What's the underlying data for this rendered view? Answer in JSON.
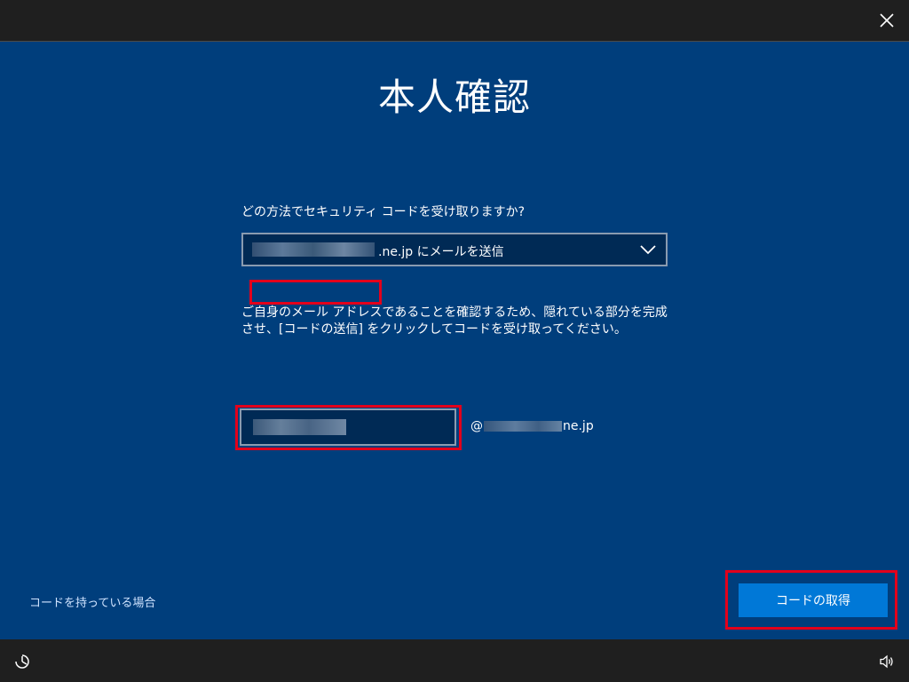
{
  "header": {
    "close_icon": "close-icon"
  },
  "main": {
    "title": "本人確認",
    "question": "どの方法でセキュリティ コードを受け取りますか?",
    "method_select": {
      "value": ".ne.jp にメールを送信"
    },
    "description": "ご自身のメール アドレスであることを確認するため、隠れている部分を完成させ、[コードの送信] をクリックしてコードを受け取ってください。",
    "email_input": {
      "value": "",
      "placeholder": ""
    },
    "domain_prefix": "@",
    "domain_suffix": "ne.jp"
  },
  "footer": {
    "have_code_link": "コードを持っている場合",
    "get_code_button": "コードの取得"
  },
  "colors": {
    "background": "#003e7c",
    "primary_button": "#0078d7",
    "highlight": "#e3001b",
    "bars": "#1f1f1f"
  }
}
